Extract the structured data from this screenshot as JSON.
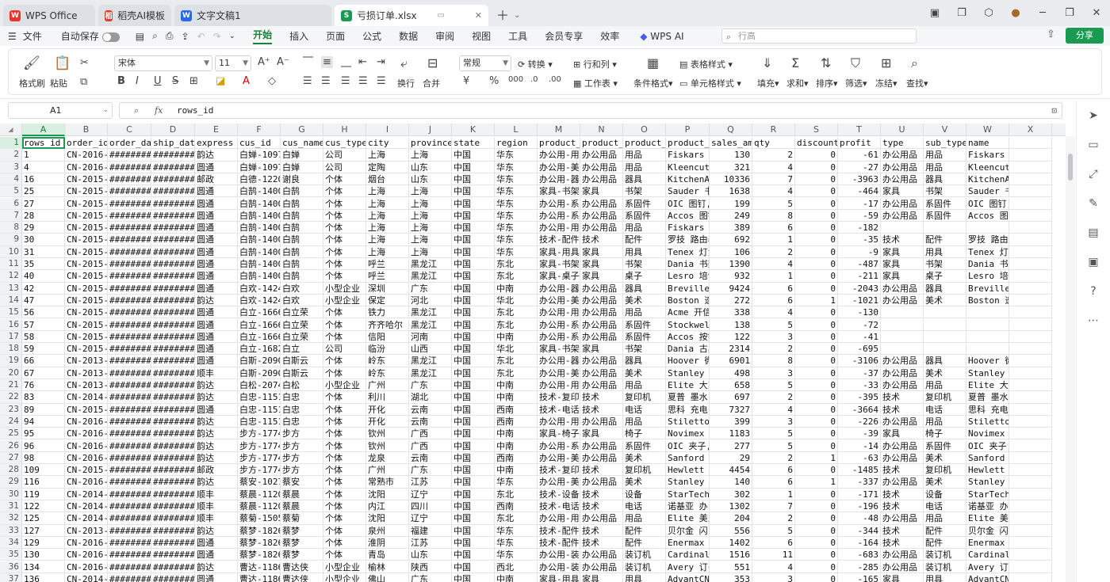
{
  "tabs": [
    {
      "label": "WPS Office",
      "icon": "wps-logo-icon",
      "color": "#e8352b"
    },
    {
      "label": "稻壳AI模板",
      "icon": "docer-icon",
      "color": "#e8352b"
    },
    {
      "label": "文字文稿1",
      "icon": "writer-icon",
      "color": "#2b67e8"
    },
    {
      "label": "亏损订单.xlsx",
      "icon": "spreadsheet-icon",
      "color": "#1a9b53"
    }
  ],
  "menu": {
    "file": "文件",
    "autosave": "自动保存",
    "items": [
      "开始",
      "插入",
      "页面",
      "公式",
      "数据",
      "审阅",
      "视图",
      "工具",
      "会员专享",
      "效率"
    ],
    "ai": "WPS AI",
    "search_placeholder": "行高",
    "share": "分享"
  },
  "ribbon": {
    "format_painter": "格式刷",
    "paste": "粘贴",
    "font": "宋体",
    "font_size": "11",
    "number_format": "常规",
    "convert": "转换",
    "rows_cols": "行和列",
    "worksheet": "工作表",
    "wrap": "换行",
    "merge": "合并",
    "cond_format": "条件格式",
    "table_style": "表格样式",
    "cell_style": "单元格样式",
    "fill": "填充",
    "sum": "求和",
    "sort": "排序",
    "filter": "筛选",
    "freeze": "冻结",
    "find": "查找"
  },
  "formula": {
    "cell_ref": "A1",
    "content": "rows_id"
  },
  "columns": [
    "A",
    "B",
    "C",
    "D",
    "E",
    "F",
    "G",
    "H",
    "I",
    "J",
    "K",
    "L",
    "M",
    "N",
    "O",
    "P",
    "Q",
    "R",
    "S",
    "T",
    "U",
    "V",
    "W",
    "X"
  ],
  "rows": [
    [
      "rows_id",
      "order_id",
      "order_dat",
      "ship_date",
      "express",
      "cus_id",
      "cus_name",
      "cus_type",
      "city",
      "province",
      "state",
      "region",
      "product_i",
      "product_t",
      "product_t",
      "product_r",
      "sales_amt",
      "qty",
      "discount",
      "profit",
      "type",
      "sub_type",
      "name",
      ""
    ],
    [
      "1",
      "CN-2016-1",
      "########",
      "########",
      "韵达",
      "白婵-1097",
      "白婵",
      "公司",
      "上海",
      "上海",
      "中国",
      "华东",
      "办公用-用",
      "办公用品",
      "用品",
      "Fiskars 剪",
      "130",
      "2",
      "0",
      "-61",
      "办公用品",
      "用品",
      "Fiskars 剪刀, 蓝色",
      ""
    ],
    [
      "4",
      "CN-2016-3",
      "########",
      "########",
      "圆通",
      "白婵-1097",
      "白婵",
      "公司",
      "定陶",
      "山东",
      "中国",
      "华东",
      "办公用-美",
      "办公用品",
      "用品",
      "Kleencut 开",
      "321",
      "4",
      "0",
      "-27",
      "办公用品",
      "用品",
      "Kleencut 开信刀, 工业",
      ""
    ],
    [
      "16",
      "CN-2015-2",
      "########",
      "########",
      "邮政",
      "白德-1220",
      "谢良",
      "个体",
      "烟台",
      "山东",
      "中国",
      "华东",
      "办公用-器",
      "办公用品",
      "器具",
      "KitchenAid",
      "10336",
      "7",
      "0",
      "-3963",
      "办公用品",
      "器具",
      "KitchenAid 冰箱, 黑色",
      ""
    ],
    [
      "25",
      "CN-2015-4",
      "########",
      "########",
      "圆通",
      "白鹄-1400",
      "白鹄",
      "个体",
      "上海",
      "上海",
      "中国",
      "华东",
      "家具-书架",
      "家具",
      "书架",
      "Sauder 书架",
      "1638",
      "4",
      "0",
      "-464",
      "家具",
      "书架",
      "Sauder 书架, 金属",
      ""
    ],
    [
      "27",
      "CN-2015-4",
      "########",
      "########",
      "圆通",
      "白鹄-1400",
      "白鹄",
      "个体",
      "上海",
      "上海",
      "中国",
      "华东",
      "办公用-系",
      "办公用品",
      "系固件",
      "OIC 图钉,",
      "199",
      "5",
      "0",
      "-17",
      "办公用品",
      "系固件",
      "OIC 图钉, 金属",
      ""
    ],
    [
      "28",
      "CN-2015-4",
      "########",
      "########",
      "圆通",
      "白鹄-1400",
      "白鹄",
      "个体",
      "上海",
      "上海",
      "中国",
      "华东",
      "办公用-系",
      "办公用品",
      "系固件",
      "Accos 图钉",
      "249",
      "8",
      "0",
      "-59",
      "办公用品",
      "系固件",
      "Accos 图钉, 混合尺寸",
      ""
    ],
    [
      "29",
      "CN-2015-4",
      "########",
      "########",
      "圆通",
      "白鹄-1400",
      "白鹄",
      "个体",
      "上海",
      "上海",
      "中国",
      "华东",
      "办公用-用",
      "办公用品",
      "用品",
      "Fiskars 剪",
      "389",
      "6",
      "0",
      "-182",
      "",
      "",
      "",
      ""
    ],
    [
      "30",
      "CN-2015-4",
      "########",
      "########",
      "圆通",
      "白鹄-1400",
      "白鹄",
      "个体",
      "上海",
      "上海",
      "中国",
      "华东",
      "技术-配件",
      "技术",
      "配件",
      "罗技 路由器",
      "692",
      "1",
      "0",
      "-35",
      "技术",
      "配件",
      "罗技 路由器, 实惠",
      ""
    ],
    [
      "31",
      "CN-2015-4",
      "########",
      "########",
      "圆通",
      "白鹄-1400",
      "白鹄",
      "个体",
      "上海",
      "上海",
      "中国",
      "华东",
      "家具-用具",
      "家具",
      "用具",
      "Tenex 灯泡",
      "106",
      "2",
      "0",
      "-9",
      "家具",
      "用具",
      "Tenex 灯泡, 黑色",
      ""
    ],
    [
      "35",
      "CN-2015-1",
      "########",
      "########",
      "圆通",
      "白鹄-1400",
      "白鹄",
      "个体",
      "呼兰",
      "黑龙江",
      "中国",
      "东北",
      "家具-书架",
      "家具",
      "书架",
      "Dania 书架",
      "1390",
      "4",
      "0",
      "-487",
      "家具",
      "书架",
      "Dania 书架, 白色",
      ""
    ],
    [
      "40",
      "CN-2015-4",
      "########",
      "########",
      "圆通",
      "白鹄-1400",
      "白鹄",
      "个体",
      "呼兰",
      "黑龙江",
      "中国",
      "东北",
      "家具-桌子",
      "家具",
      "桌子",
      "Lesro 培训",
      "932",
      "1",
      "0",
      "-211",
      "家具",
      "桌子",
      "Lesro 培训桌, 长方形",
      ""
    ],
    [
      "42",
      "CN-2015-3",
      "########",
      "########",
      "圆通",
      "白欢-1424",
      "白欢",
      "小型企业",
      "深圳",
      "广东",
      "中国",
      "中南",
      "办公用-器",
      "办公用品",
      "器具",
      "Breville",
      "9424",
      "6",
      "0",
      "-2043",
      "办公用品",
      "器具",
      "Breville 炉灶, 黑色",
      ""
    ],
    [
      "47",
      "CN-2015-5",
      "########",
      "########",
      "韵达",
      "白欢-1424",
      "白欢",
      "小型企业",
      "保定",
      "河北",
      "中国",
      "华北",
      "办公用-美",
      "办公用品",
      "美术",
      "Boston 速",
      "272",
      "6",
      "1",
      "-1021",
      "办公用品",
      "美术",
      "Boston 速写本, 蓝色",
      ""
    ],
    [
      "56",
      "CN-2015-4",
      "########",
      "########",
      "圆通",
      "白立-1666",
      "白立荣",
      "个体",
      "铁力",
      "黑龙江",
      "中国",
      "东北",
      "办公用-用",
      "办公用品",
      "用品",
      "Acme 开信",
      "338",
      "4",
      "0",
      "-130",
      "",
      "",
      "",
      ""
    ],
    [
      "57",
      "CN-2015-4",
      "########",
      "########",
      "圆通",
      "白立-1666",
      "白立荣",
      "个体",
      "齐齐哈尔",
      "黑龙江",
      "中国",
      "东北",
      "办公用-系",
      "办公用品",
      "系固件",
      "Stockwell",
      "138",
      "5",
      "0",
      "-72",
      "",
      "",
      "",
      ""
    ],
    [
      "58",
      "CN-2015-4",
      "########",
      "########",
      "圆通",
      "白立-1666",
      "白立荣",
      "个体",
      "信阳",
      "河南",
      "中国",
      "中南",
      "办公用-系",
      "办公用品",
      "系固件",
      "Accos 按钉",
      "122",
      "3",
      "0",
      "-41",
      "",
      "",
      "",
      ""
    ],
    [
      "59",
      "CN-2015-4",
      "########",
      "########",
      "圆通",
      "白立-1682",
      "白立",
      "公司",
      "临汾",
      "山西",
      "中国",
      "华北",
      "家具-书架",
      "家具",
      "书架",
      "Dania 古典",
      "2314",
      "2",
      "0",
      "-695",
      "",
      "",
      "",
      ""
    ],
    [
      "66",
      "CN-2013-3",
      "########",
      "########",
      "圆通",
      "白斯-2090",
      "白斯云",
      "个体",
      "岭东",
      "黑龙江",
      "中国",
      "东北",
      "办公用-器",
      "办公用品",
      "器具",
      "Hoover 微",
      "6901",
      "8",
      "0",
      "-3106",
      "办公用品",
      "器具",
      "Hoover 微波炉, 黑色",
      ""
    ],
    [
      "67",
      "CN-2013-1",
      "########",
      "########",
      "顺丰",
      "白斯-2090",
      "白斯云",
      "个体",
      "岭东",
      "黑龙江",
      "中国",
      "东北",
      "办公用-美",
      "办公用品",
      "美术",
      "Stanley 速",
      "498",
      "3",
      "0",
      "-37",
      "办公用品",
      "美术",
      "Stanley 速写本, 蓝色",
      ""
    ],
    [
      "76",
      "CN-2013-3",
      "########",
      "########",
      "韵达",
      "白松-2074",
      "白松",
      "小型企业",
      "广州",
      "广东",
      "中国",
      "中南",
      "办公用-用",
      "办公用品",
      "用品",
      "Elite 大剪",
      "658",
      "5",
      "0",
      "-33",
      "办公用品",
      "用品",
      "Elite 大剪刀, 蓝色",
      ""
    ],
    [
      "83",
      "CN-2014-1",
      "########",
      "########",
      "韵达",
      "白忠-1151",
      "白忠",
      "个体",
      "利川",
      "湖北",
      "中国",
      "中南",
      "技术-复印",
      "技术",
      "复印机",
      "夏普 墨水",
      "697",
      "2",
      "0",
      "-395",
      "技术",
      "复印机",
      "夏普 墨水, 每套两件",
      ""
    ],
    [
      "89",
      "CN-2015-1",
      "########",
      "########",
      "圆通",
      "白忠-1151",
      "白忠",
      "个体",
      "开化",
      "云南",
      "中国",
      "西南",
      "技术-电话",
      "技术",
      "电话",
      "思科 充电",
      "7327",
      "4",
      "0",
      "-3664",
      "技术",
      "电话",
      "思科 充电器, 混合尺寸",
      ""
    ],
    [
      "94",
      "CN-2016-4",
      "########",
      "########",
      "韵达",
      "白忠-1151",
      "白忠",
      "个体",
      "开化",
      "云南",
      "中国",
      "西南",
      "办公用-用",
      "办公用品",
      "用品",
      "Stiletto",
      "399",
      "3",
      "0",
      "-226",
      "办公用品",
      "用品",
      "Stiletto 大剪刀, 钢",
      ""
    ],
    [
      "95",
      "CN-2016-4",
      "########",
      "########",
      "韵达",
      "步方-1774",
      "步方",
      "个体",
      "钦州",
      "广西",
      "中国",
      "中南",
      "家具-椅子",
      "家具",
      "椅子",
      "Novimex 折",
      "1183",
      "5",
      "0",
      "-39",
      "家具",
      "椅子",
      "Novimex 折叠椅, 每套",
      ""
    ],
    [
      "96",
      "CN-2016-4",
      "########",
      "########",
      "韵达",
      "步方-1774",
      "步方",
      "个体",
      "钦州",
      "广西",
      "中国",
      "中南",
      "办公用-系",
      "办公用品",
      "系固件",
      "OIC 夹子,",
      "277",
      "5",
      "0",
      "-14",
      "办公用品",
      "系固件",
      "OIC 夹子, 整包",
      ""
    ],
    [
      "98",
      "CN-2016-4",
      "########",
      "########",
      "韵达",
      "步方-1774",
      "步方",
      "个体",
      "龙泉",
      "云南",
      "中国",
      "西南",
      "办公用-美",
      "办公用品",
      "美术",
      "Sanford 荧",
      "29",
      "2",
      "1",
      "-63",
      "办公用品",
      "美术",
      "Sanford 荧光笔, 蓝色",
      ""
    ],
    [
      "109",
      "CN-2015-2",
      "########",
      "########",
      "邮政",
      "步方-1774",
      "步方",
      "个体",
      "广州",
      "广东",
      "中国",
      "中南",
      "技术-复印",
      "技术",
      "复印机",
      "Hewlett 复",
      "4454",
      "6",
      "0",
      "-1485",
      "技术",
      "复印机",
      "Hewlett 复印机, 彩色",
      ""
    ],
    [
      "116",
      "CN-2016-4",
      "########",
      "########",
      "韵达",
      "蔡安-1027",
      "蔡安",
      "个体",
      "常熟市",
      "江苏",
      "中国",
      "华东",
      "办公用-美",
      "办公用品",
      "美术",
      "Stanley 铅",
      "140",
      "6",
      "1",
      "-337",
      "办公用品",
      "美术",
      "Stanley 铅笔刀, 整包",
      ""
    ],
    [
      "119",
      "CN-2014-3",
      "########",
      "########",
      "顺丰",
      "蔡晨-1120",
      "蔡晨",
      "个体",
      "沈阳",
      "辽宁",
      "中国",
      "东北",
      "技术-设备",
      "技术",
      "设备",
      "StarTech",
      "302",
      "1",
      "0",
      "-171",
      "技术",
      "设备",
      "StarTech 收据打印机,",
      ""
    ],
    [
      "122",
      "CN-2014-3",
      "########",
      "########",
      "顺丰",
      "蔡晨-1120",
      "蔡晨",
      "个体",
      "内江",
      "四川",
      "中国",
      "西南",
      "技术-电话",
      "技术",
      "电话",
      "诺基亚 办",
      "1302",
      "7",
      "0",
      "-196",
      "技术",
      "电话",
      "诺基亚 办公室电话机,",
      ""
    ],
    [
      "125",
      "CN-2014-3",
      "########",
      "########",
      "顺丰",
      "蔡菊-1505",
      "蔡菊",
      "个体",
      "沈阳",
      "辽宁",
      "中国",
      "东北",
      "办公用-用",
      "办公用品",
      "用品",
      "Elite 美工",
      "204",
      "2",
      "0",
      "-48",
      "办公用品",
      "用品",
      "Elite 美工刀, 工业",
      ""
    ],
    [
      "127",
      "CN-2013-3",
      "########",
      "########",
      "韵达",
      "蔡梦-1826",
      "蔡梦",
      "个体",
      "泉州",
      "福建",
      "中国",
      "华东",
      "技术-配件",
      "技术",
      "配件",
      "贝尔金 闪",
      "556",
      "5",
      "0",
      "-344",
      "技术",
      "配件",
      "贝尔金 闪存驱动器,",
      ""
    ],
    [
      "129",
      "CN-2016-2",
      "########",
      "########",
      "圆通",
      "蔡梦-1826",
      "蔡梦",
      "个体",
      "淮阴",
      "江苏",
      "中国",
      "华东",
      "技术-配件",
      "技术",
      "配件",
      "Enermax 键",
      "1402",
      "6",
      "0",
      "-164",
      "技术",
      "配件",
      "Enermax 键盘, 实惠",
      ""
    ],
    [
      "130",
      "CN-2016-2",
      "########",
      "########",
      "圆通",
      "蔡梦-1826",
      "蔡梦",
      "个体",
      "青岛",
      "山东",
      "中国",
      "华东",
      "办公用-装",
      "办公用品",
      "装订机",
      "Cardinal",
      "1516",
      "11",
      "0",
      "-683",
      "办公用品",
      "装订机",
      "Cardinal 订书机, 透明",
      ""
    ],
    [
      "134",
      "CN-2016-4",
      "########",
      "########",
      "韵达",
      "曹达-1186",
      "曹达侠",
      "小型企业",
      "榆林",
      "陕西",
      "中国",
      "西北",
      "办公用-装",
      "办公用品",
      "装订机",
      "Avery 订书",
      "551",
      "4",
      "0",
      "-285",
      "办公用品",
      "装订机",
      "Avery 订书机, 回收",
      ""
    ],
    [
      "136",
      "CN-2014-2",
      "########",
      "########",
      "圆通",
      "曹达-1186",
      "曹达侠",
      "小型企业",
      "佛山",
      "广东",
      "中国",
      "中南",
      "家具-用具",
      "家具",
      "用具",
      "AdvantCN",
      "353",
      "3",
      "0",
      "-165",
      "家具",
      "用具",
      "AdvantCN 门挡, 耐用",
      ""
    ]
  ]
}
